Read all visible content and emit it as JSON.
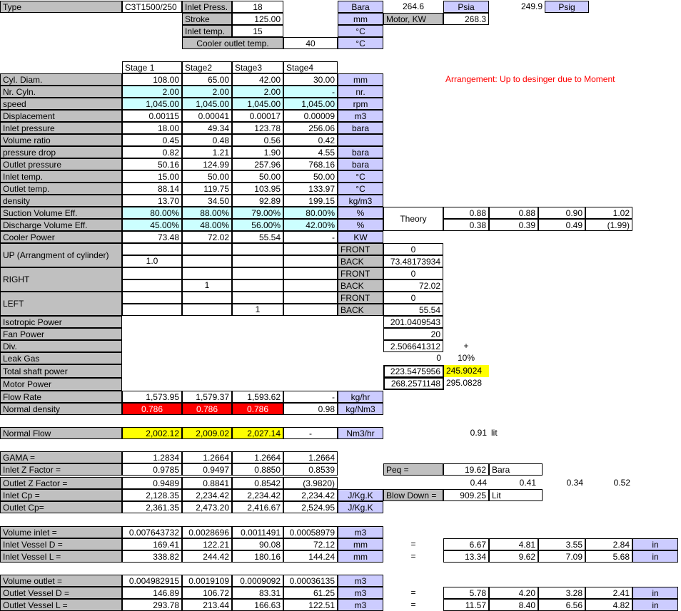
{
  "top": {
    "type_label": "Type",
    "type_value": "C3T1500/250",
    "inlet_press_label": "Inlet Press.",
    "inlet_press_value": "18",
    "stroke_label": "Stroke",
    "stroke_value": "125.00",
    "inlet_temp_label": "Inlet temp.",
    "inlet_temp_value": "15",
    "cooler_outlet_label": "Cooler outlet temp.",
    "cooler_outlet_value": "40",
    "unit_bara": "Bara",
    "unit_mm": "mm",
    "unit_c1": "°C",
    "unit_c2": "°C",
    "bara_value": "264.6",
    "psia_label": "Psia",
    "psia_value": "249.9",
    "psig_label": "Psig",
    "motor_label": "Motor, KW",
    "motor_value": "268.3"
  },
  "stages": [
    "Stage 1",
    "Stage2",
    "Stage3",
    "Stage4"
  ],
  "arrangement_note": "Arrangement: Up to desinger due to Moment",
  "rows": [
    {
      "label": "Cyl. Diam.",
      "v": [
        "108.00",
        "65.00",
        "42.00",
        "30.00"
      ],
      "unit": "mm"
    },
    {
      "label": "Nr. Cyln.",
      "v": [
        "2.00",
        "2.00",
        "2.00",
        "-"
      ],
      "unit": "nr."
    },
    {
      "label": "speed",
      "v": [
        "1,045.00",
        "1,045.00",
        "1,045.00",
        "1,045.00"
      ],
      "unit": "rpm"
    },
    {
      "label": "Displacement",
      "v": [
        "0.00115",
        "0.00041",
        "0.00017",
        "0.00009"
      ],
      "unit": "m3"
    },
    {
      "label": "Inlet pressure",
      "v": [
        "18.00",
        "49.34",
        "123.78",
        "256.06"
      ],
      "unit": "bara"
    },
    {
      "label": "Volume ratio",
      "v": [
        "0.45",
        "0.48",
        "0.56",
        "0.42"
      ],
      "unit": ""
    },
    {
      "label": "pressure drop",
      "v": [
        "0.82",
        "1.21",
        "1.90",
        "4.55"
      ],
      "unit": "bara"
    },
    {
      "label": "Outlet pressure",
      "v": [
        "50.16",
        "124.99",
        "257.96",
        "768.16"
      ],
      "unit": "bara"
    },
    {
      "label": "Inlet temp.",
      "v": [
        "15.00",
        "50.00",
        "50.00",
        "50.00"
      ],
      "unit": "°C"
    },
    {
      "label": "Outlet temp.",
      "v": [
        "88.14",
        "119.75",
        "103.95",
        "133.97"
      ],
      "unit": "°C"
    },
    {
      "label": "density",
      "v": [
        "13.70",
        "34.50",
        "92.89",
        "199.15"
      ],
      "unit": "kg/m3"
    },
    {
      "label": "Suction Volume Eff.",
      "v": [
        "80.00%",
        "88.00%",
        "79.00%",
        "80.00%"
      ],
      "unit": "%"
    },
    {
      "label": "Discharge Volume Eff.",
      "v": [
        "45.00%",
        "48.00%",
        "56.00%",
        "42.00%"
      ],
      "unit": "%"
    },
    {
      "label": "Cooler Power",
      "v": [
        "73.48",
        "72.02",
        "55.54",
        "-"
      ],
      "unit": "KW"
    }
  ],
  "theory": {
    "label": "Theory",
    "row1": [
      "0.88",
      "0.88",
      "0.90",
      "1.02"
    ],
    "row2": [
      "0.38",
      "0.39",
      "0.49",
      "(1.99)"
    ]
  },
  "arrangement": {
    "up_label": "UP (Arrangment of cylinder)",
    "up_value": "1.0",
    "right_label": "RIGHT",
    "right_value": "1",
    "left_label": "LEFT",
    "left_value": "1",
    "front": "FRONT",
    "back": "BACK",
    "up_front": "0",
    "up_back": "73.48173934",
    "right_front": "0",
    "right_back": "72.02",
    "left_front": "0",
    "left_back": "55.54"
  },
  "power": {
    "isotropic_label": "Isotropic Power",
    "isotropic_value": "201.0409543",
    "fan_label": "Fan Power",
    "fan_value": "20",
    "div_label": "Div.",
    "div_value": "2.506641312",
    "plus": "+",
    "leak_label": "Leak Gas",
    "leak_value": "0",
    "leak_pct": "10%",
    "total_label": "Total shaft power",
    "total_value": "223.5475956",
    "total_plus": "245.9024",
    "motor_label": "Motor Power",
    "motor_value": "268.2571148",
    "motor_plus": "295.0828"
  },
  "flow": {
    "flow_rate_label": "Flow Rate",
    "flow_rate": [
      "1,573.95",
      "1,579.37",
      "1,593.62",
      "-"
    ],
    "flow_rate_unit": "kg/hr",
    "normal_density_label": "Normal density",
    "normal_density": [
      "0.786",
      "0.786",
      "0.786",
      "0.98"
    ],
    "normal_density_unit": "kg/Nm3",
    "normal_flow_label": "Normal Flow",
    "normal_flow": [
      "2,002.12",
      "2,009.02",
      "2,027.14",
      "-"
    ],
    "normal_flow_unit": "Nm3/hr",
    "lit_value": "0.91",
    "lit_unit": "lit"
  },
  "gas": {
    "gama_label": "GAMA  =",
    "gama": [
      "1.2834",
      "1.2664",
      "1.2664",
      "1.2664"
    ],
    "inz_label": "Inlet Z Factor  =",
    "inz": [
      "0.9785",
      "0.9497",
      "0.8850",
      "0.8539"
    ],
    "outz_label": "Outlet Z Factor  =",
    "outz": [
      "0.9489",
      "0.8841",
      "0.8542",
      "(3.9820)"
    ],
    "incp_label": "Inlet Cp  =",
    "incp": [
      "2,128.35",
      "2,234.42",
      "2,234.42",
      "2,234.42"
    ],
    "incp_unit": "J/Kg.K",
    "outcp_label": "Outlet Cp=",
    "outcp": [
      "2,361.35",
      "2,473.20",
      "2,416.67",
      "2,524.95"
    ],
    "outcp_unit": "J/Kg.K",
    "peq_label": "Peq =",
    "peq_value": "19.62",
    "peq_unit": "Bara",
    "extra": [
      "0.44",
      "0.41",
      "0.34",
      "0.52"
    ],
    "blow_label": "Blow Down =",
    "blow_value": "909.25",
    "blow_unit": "Lit"
  },
  "vessel_in": {
    "vol_label": "Volume inlet =",
    "vol": [
      "0.007643732",
      "0.0028696",
      "0.0011491",
      "0.00058979"
    ],
    "vol_unit": "m3",
    "d_label": "Inlet Vessel D =",
    "d": [
      "169.41",
      "122.21",
      "90.08",
      "72.12"
    ],
    "d_unit": "mm",
    "l_label": "Inlet Vessel L =",
    "l": [
      "338.82",
      "244.42",
      "180.16",
      "144.24"
    ],
    "l_unit": "mm",
    "eq": "=",
    "d_in": [
      "6.67",
      "4.81",
      "3.55",
      "2.84"
    ],
    "l_in": [
      "13.34",
      "9.62",
      "7.09",
      "5.68"
    ],
    "in_unit": "in"
  },
  "vessel_out": {
    "vol_label": "Volume outlet =",
    "vol": [
      "0.004982915",
      "0.0019109",
      "0.0009092",
      "0.00036135"
    ],
    "vol_unit": "m3",
    "d_label": "Outlet Vessel D =",
    "d": [
      "146.89",
      "106.72",
      "83.31",
      "61.25"
    ],
    "d_unit": "m3",
    "l_label": "Outlet Vessel L =",
    "l": [
      "293.78",
      "213.44",
      "166.63",
      "122.51"
    ],
    "l_unit": "m3",
    "eq": "=",
    "d_in": [
      "5.78",
      "4.20",
      "3.28",
      "2.41"
    ],
    "l_in": [
      "11.57",
      "8.40",
      "6.56",
      "4.82"
    ],
    "in_unit": "in"
  }
}
